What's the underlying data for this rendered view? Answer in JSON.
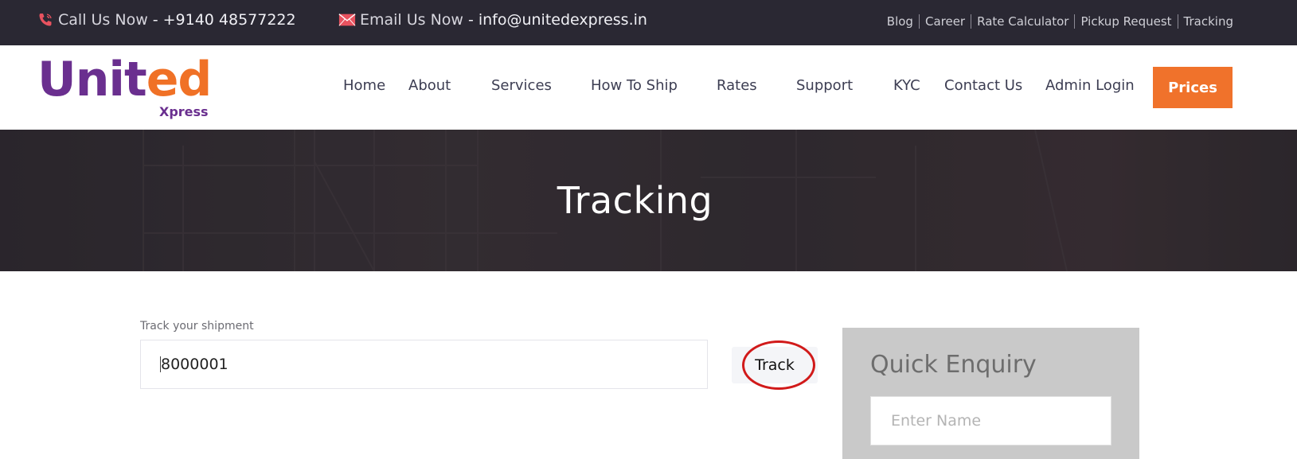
{
  "topbar": {
    "call_label": "Call Us Now",
    "call_value": "+9140 48577222",
    "email_label": "Email Us Now",
    "email_value": "info@unitedexpress.in",
    "links": [
      "Blog",
      "Career",
      "Rate Calculator",
      "Pickup Request",
      "Tracking"
    ],
    "icon_color": "#e8525f"
  },
  "logo": {
    "word_part1": "Unit",
    "word_part2": "ed",
    "sub": "Xpress",
    "color_purple": "#6a2f8f",
    "color_orange": "#f07126"
  },
  "nav": {
    "items": [
      "Home",
      "About",
      "Services",
      "How To Ship",
      "Rates",
      "Support",
      "KYC",
      "Contact Us",
      "Admin Login"
    ],
    "cta_label": "Prices",
    "cta_color": "#f0722b"
  },
  "banner": {
    "title": "Tracking"
  },
  "tracking": {
    "label": "Track your shipment",
    "value": "8000001",
    "button_label": "Track",
    "highlight_color": "#d11a1a"
  },
  "enquiry": {
    "title": "Quick Enquiry",
    "name_placeholder": "Enter Name"
  }
}
